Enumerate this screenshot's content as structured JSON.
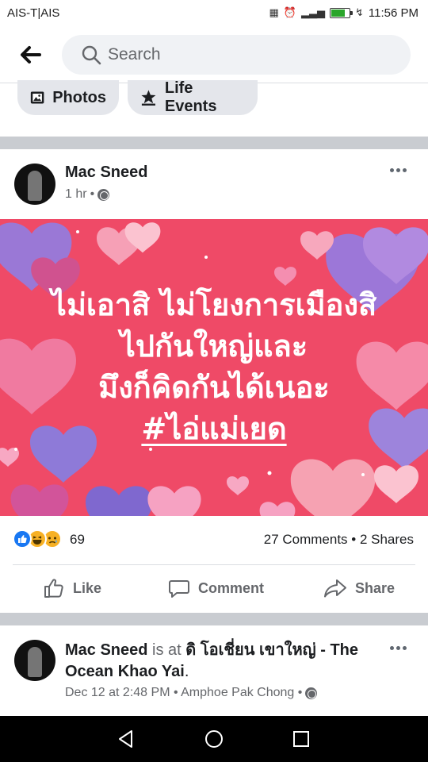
{
  "status_bar": {
    "carrier": "AIS-T|AIS",
    "time": "11:56 PM",
    "battery_level": 0.75,
    "battery_color": "#2aa52a"
  },
  "search": {
    "placeholder": "Search"
  },
  "chips": [
    {
      "label": "Photos",
      "icon": "photos-icon"
    },
    {
      "label": "Life Events",
      "icon": "life-events-icon"
    }
  ],
  "posts": [
    {
      "author": "Mac Sneed",
      "time": "1 hr",
      "privacy_icon": "globe-icon",
      "image_text_lines": [
        "ไม่เอาสิ ไม่โยงการเมืองสิ",
        "ไปกันใหญ่และ",
        "มึงก็คิดกันได้เนอะ"
      ],
      "image_hashtag": "#ไอ่แม่เยด",
      "image_bg_color": "#ee4d6a",
      "reaction_count": "69",
      "reaction_icons": [
        "like-reaction-icon",
        "haha-reaction-icon",
        "sad-reaction-icon"
      ],
      "comments_shares": "27 Comments • 2 Shares",
      "actions": {
        "like": "Like",
        "comment": "Comment",
        "share": "Share"
      }
    },
    {
      "author": "Mac Sneed",
      "connector": "is at",
      "place_thai": "ดิ โอเชี่ยน เขาใหญ่ -",
      "place_en": "The Ocean Khao Yai",
      "period": ".",
      "meta": "Dec 12 at 2:48 PM • Amphoe Pak Chong •",
      "privacy_icon": "globe-icon"
    }
  ],
  "colors": {
    "facebook_blue": "#1877f2",
    "secondary_text": "#65676b",
    "divider": "#c9ccd1"
  }
}
